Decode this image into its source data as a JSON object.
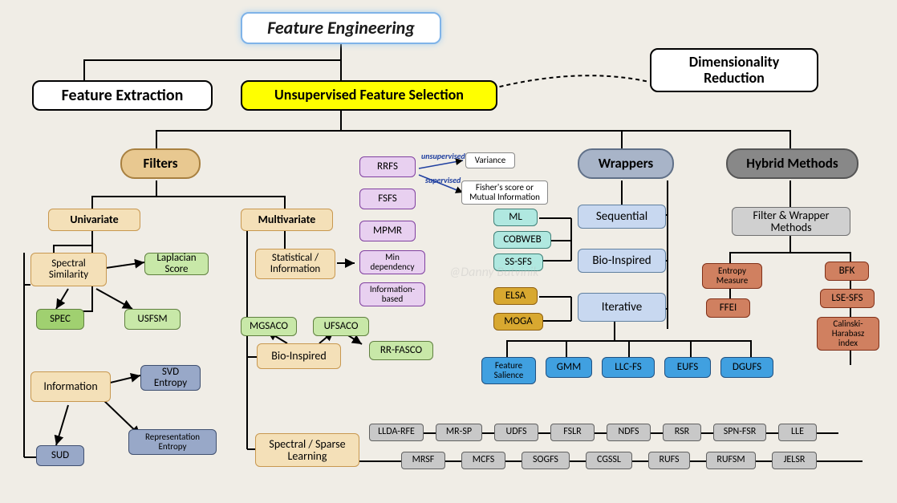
{
  "title": "Feature Engineering",
  "feature_extraction": "Feature Extraction",
  "ufs": "Unsupervised Feature Selection",
  "dim_red": "Dimensionality Reduction",
  "filters": "Filters",
  "wrappers": "Wrappers",
  "hybrid": "Hybrid Methods",
  "univariate": "Univariate",
  "multivariate": "Multivariate",
  "spectral_sim": "Spectral Similarity",
  "laplacian": "Laplacian Score",
  "spec": "SPEC",
  "usfsm": "USFSM",
  "information": "Information",
  "svd": "SVD Entropy",
  "sud": "SUD",
  "repr_ent": "Representation Entropy",
  "stat_info": "Statistical / Information",
  "bio_u": "Bio-Inspired",
  "ssl": "Spectral / Sparse Learning",
  "rrfs": "RRFS",
  "fsfs": "FSFS",
  "mpmr": "MPMR",
  "mindep": "Min dependency",
  "infobased": "Information-based",
  "variance": "Variance",
  "fisher": "Fisher's score or Mutual Information",
  "lab_unsup": "unsupervised",
  "lab_sup": "supervised",
  "mgsaco": "MGSACO",
  "ufsaco": "UFSACO",
  "rrfasco": "RR-FASCO",
  "ml": "ML",
  "cobweb": "COBWEB",
  "sssfs": "SS-SFS",
  "sequential": "Sequential",
  "bio_w": "Bio-Inspired",
  "iterative": "Iterative",
  "elsa": "ELSA",
  "moga": "MOGA",
  "fsal": "Feature Salience",
  "gmm": "GMM",
  "llcfs": "LLC-FS",
  "eufs": "EUFS",
  "dgufs": "DGUFS",
  "fwm": "Filter & Wrapper Methods",
  "entmeas": "Entropy Measure",
  "ffei": "FFEI",
  "bfk": "BFK",
  "lsesfs": "LSE-SFS",
  "chindex": "Calinski-Harabasz index",
  "g": {
    "llda": "LLDA-RFE",
    "mrsp": "MR-SP",
    "udfs": "UDFS",
    "fslr": "FSLR",
    "ndfs": "NDFS",
    "rsr": "RSR",
    "spnfsr": "SPN-FSR",
    "lle": "LLE",
    "mrsf": "MRSF",
    "mcfs": "MCFS",
    "sogfs": "SOGFS",
    "cgssl": "CGSSL",
    "rufs": "RUFS",
    "rufsm": "RUFSM",
    "jelsr": "JELSR"
  },
  "watermark": "@Danny Butvinik"
}
